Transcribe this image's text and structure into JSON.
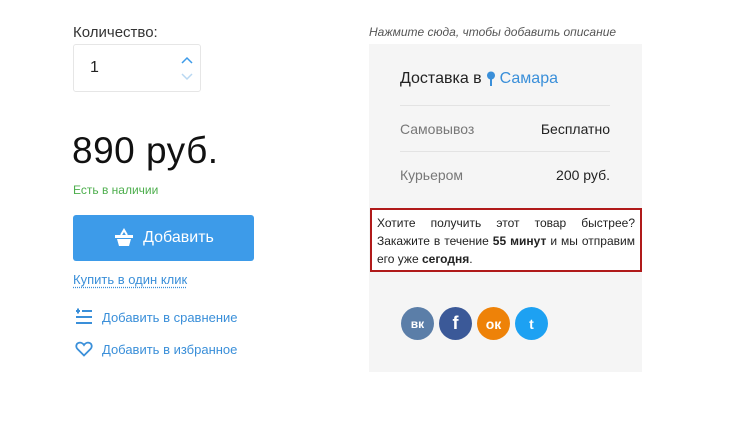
{
  "quantity": {
    "label": "Количество:",
    "value": "1"
  },
  "price": "890 руб.",
  "stock_status": "Есть в наличии",
  "add_button": {
    "label": "Добавить",
    "icon": "basket-icon"
  },
  "one_click": "Купить в один клик",
  "compare": {
    "label": "Добавить в сравнение",
    "icon": "compare-icon"
  },
  "favorites": {
    "label": "Добавить в избранное",
    "icon": "heart-icon"
  },
  "description_hint": "Нажмите сюда, чтобы добавить описание",
  "delivery": {
    "title": "Доставка в",
    "city": "Самара",
    "options": [
      {
        "name": "Самовывоз",
        "price": "Бесплатно"
      },
      {
        "name": "Курьером",
        "price": "200 руб."
      }
    ]
  },
  "notice": {
    "part1": "Хотите получить этот товар быстрее? Закажите в течение ",
    "time": "55 минут",
    "part2": " и мы отправим его уже ",
    "day": "сегодня",
    "part3": "."
  },
  "social": [
    {
      "name": "vk",
      "glyph": "вк"
    },
    {
      "name": "facebook",
      "glyph": "f"
    },
    {
      "name": "odnoklassniki",
      "glyph": "ок"
    },
    {
      "name": "twitter",
      "glyph": "t"
    }
  ],
  "colors": {
    "accent": "#3d9be9",
    "link": "#3a8fd9",
    "in_stock": "#4cae4c",
    "notice_border": "#b01a1a"
  }
}
